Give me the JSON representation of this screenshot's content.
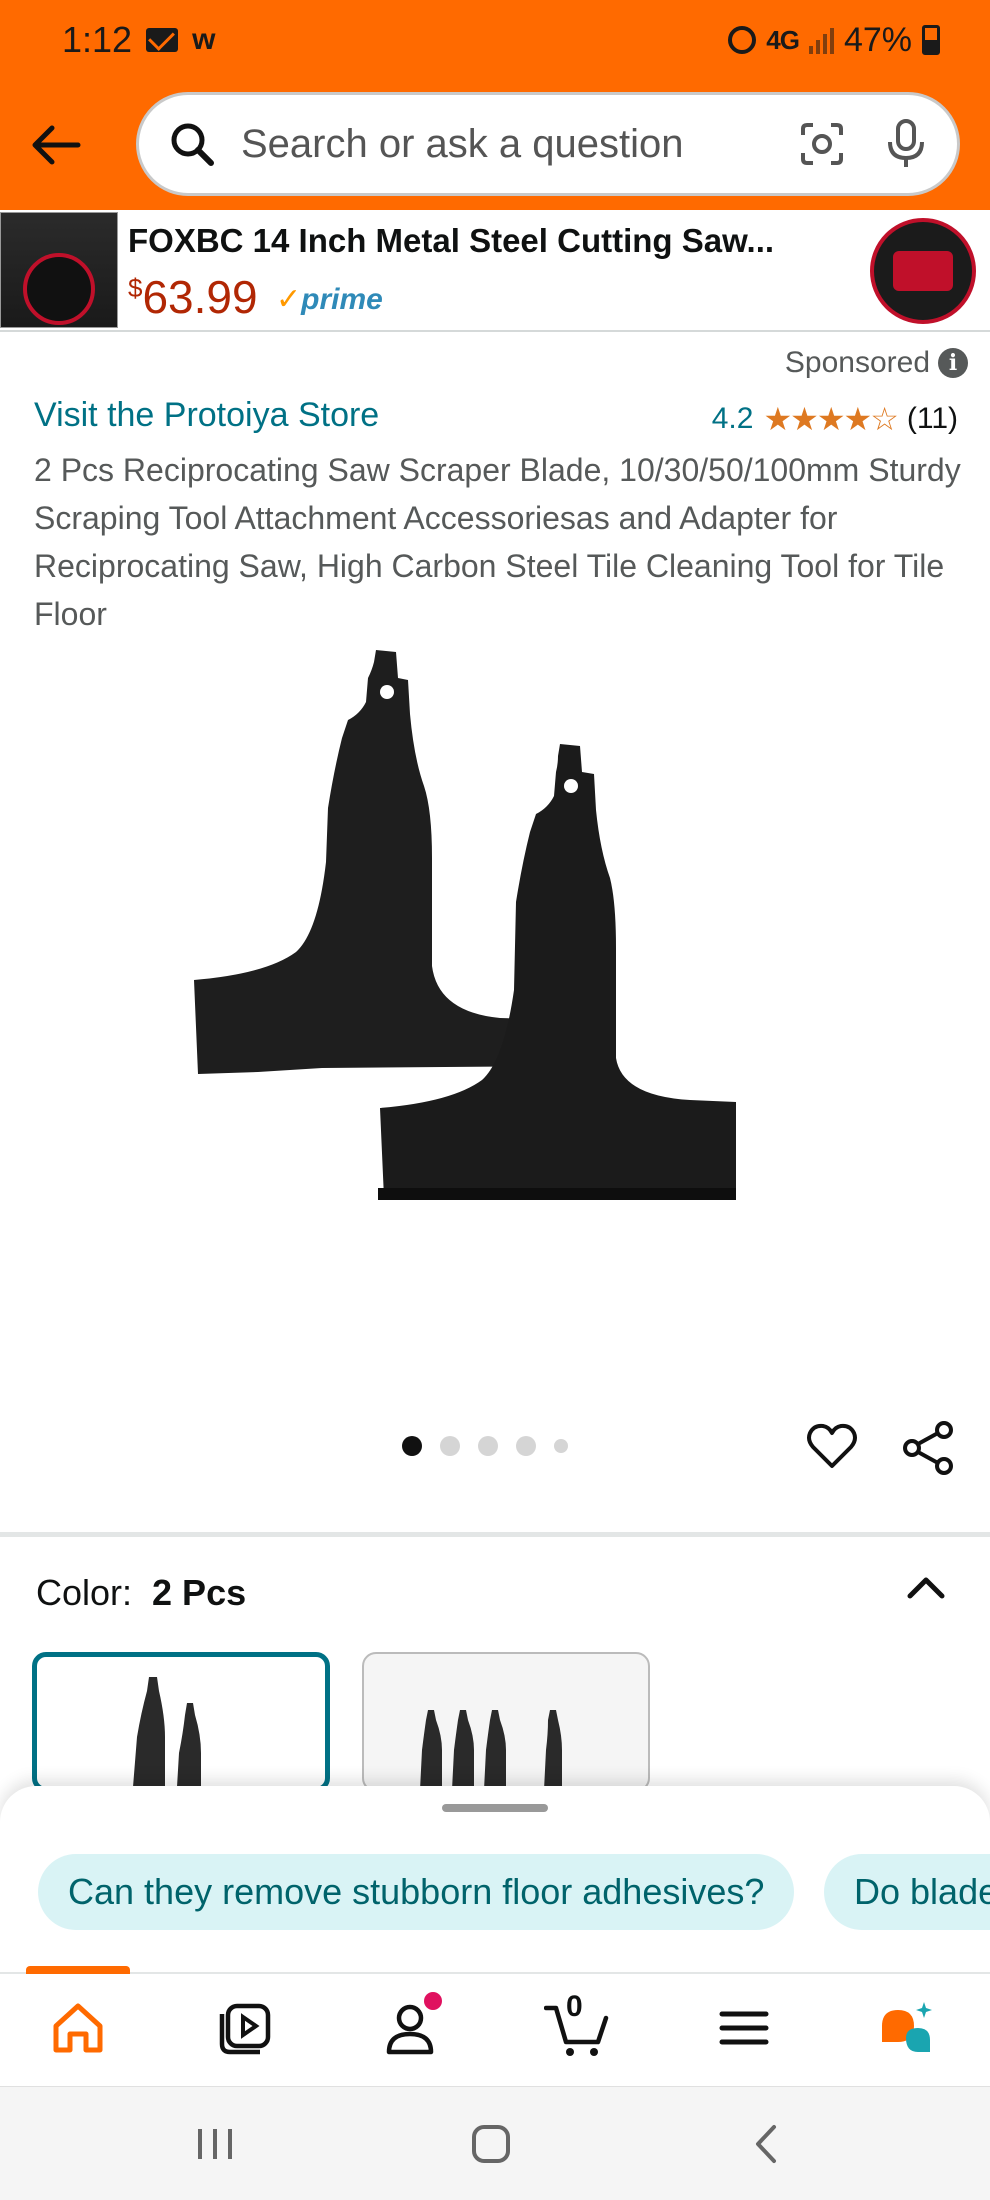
{
  "status_bar": {
    "time": "1:12",
    "extra": "w",
    "network": "4G",
    "battery": "47%"
  },
  "header": {
    "search_placeholder": "Search or ask a question"
  },
  "ad_banner": {
    "title": "FOXBC 14 Inch Metal Steel Cutting Saw...",
    "currency": "$",
    "price": "63.99",
    "prime_label": "prime"
  },
  "product": {
    "sponsored_label": "Sponsored",
    "store_link": "Visit the Protoiya Store",
    "rating": "4.2",
    "stars": "★★★★☆",
    "review_count": "(11)",
    "title": "2 Pcs Reciprocating Saw Scraper Blade, 10/30/50/100mm Sturdy Scraping Tool Attachment Accessoriesas and Adapter for Reciprocating Saw, High Carbon Steel Tile Cleaning Tool for Tile Floor"
  },
  "gallery": {
    "active_index": 0,
    "count": 5
  },
  "color_selector": {
    "label": "Color:",
    "selected": "2 Pcs"
  },
  "sheet": {
    "questions": [
      "Can they remove stubborn floor adhesives?",
      "Do blade"
    ]
  },
  "bottom_nav": {
    "cart_count": "0",
    "items": [
      "home-icon",
      "video-icon",
      "account-icon",
      "cart-icon",
      "menu-icon",
      "rufus-icon"
    ]
  },
  "colors": {
    "accent": "#ff6a00",
    "link": "#007185",
    "price": "#b12704",
    "star": "#de7921"
  }
}
